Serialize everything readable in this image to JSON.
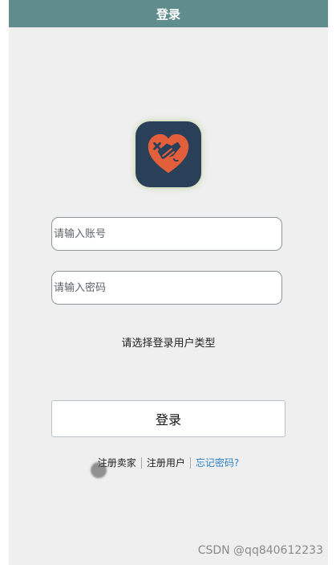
{
  "header": {
    "title": "登录"
  },
  "logo": {
    "icon": "heart-handshake-icon",
    "colors": {
      "background": "#2a3f58",
      "heart": "#e35f3c",
      "glow": "#b3ce7d"
    }
  },
  "form": {
    "account_placeholder": "请输入账号",
    "password_placeholder": "请输入密码",
    "user_type_prompt": "请选择登录用户类型",
    "login_label": "登录"
  },
  "links": {
    "register_seller": "注册卖家",
    "register_user": "注册用户",
    "forgot_password": "忘记密码?"
  },
  "watermark": "CSDN @qq840612233",
  "colors": {
    "header": "#5f8d8b",
    "background": "#efeff0",
    "link_accent": "#2d7fc5"
  }
}
